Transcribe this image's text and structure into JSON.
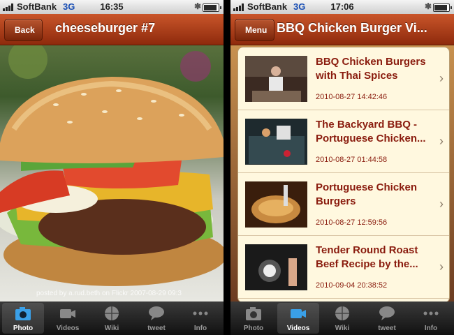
{
  "left_screen": {
    "status": {
      "carrier": "SoftBank",
      "network": "3G",
      "time": "16:35"
    },
    "nav": {
      "back_label": "Back",
      "title": "cheeseburger #7"
    },
    "photo": {
      "subject": "cheeseburger",
      "credit": "posted by a.rud.beth on Flickr 2007-08-29 09:3"
    },
    "tabs": [
      {
        "label": "Photo",
        "icon": "camera-icon",
        "active": true
      },
      {
        "label": "Videos",
        "icon": "video-camera-icon",
        "active": false
      },
      {
        "label": "Wiki",
        "icon": "globe-icon",
        "active": false
      },
      {
        "label": "tweet",
        "icon": "speech-bubble-icon",
        "active": false
      },
      {
        "label": "Info",
        "icon": "more-dots-icon",
        "active": false
      }
    ]
  },
  "right_screen": {
    "status": {
      "carrier": "SoftBank",
      "network": "3G",
      "time": "17:06"
    },
    "nav": {
      "menu_label": "Menu",
      "title": "BBQ Chicken Burger Vi..."
    },
    "videos": [
      {
        "title": "BBQ Chicken Burgers\nwith Thai Spices",
        "date": "2010-08-27 14:42:46"
      },
      {
        "title": "The Backyard BBQ -\nPortuguese Chicken...",
        "date": "2010-08-27 01:44:58"
      },
      {
        "title": "Portuguese Chicken\nBurgers",
        "date": "2010-08-27 12:59:56"
      },
      {
        "title": "Tender Round Roast\nBeef Recipe by the...",
        "date": "2010-09-04 20:38:52"
      }
    ],
    "tabs": [
      {
        "label": "Photo",
        "icon": "camera-icon",
        "active": false
      },
      {
        "label": "Videos",
        "icon": "video-camera-icon",
        "active": true
      },
      {
        "label": "Wiki",
        "icon": "globe-icon",
        "active": false
      },
      {
        "label": "tweet",
        "icon": "speech-bubble-icon",
        "active": false
      },
      {
        "label": "Info",
        "icon": "more-dots-icon",
        "active": false
      }
    ]
  },
  "colors": {
    "navbar": "#a8411c",
    "title_text": "#8a1c0e",
    "list_bg": "#fff8df",
    "tab_active_icon": "#3aa0e8"
  }
}
